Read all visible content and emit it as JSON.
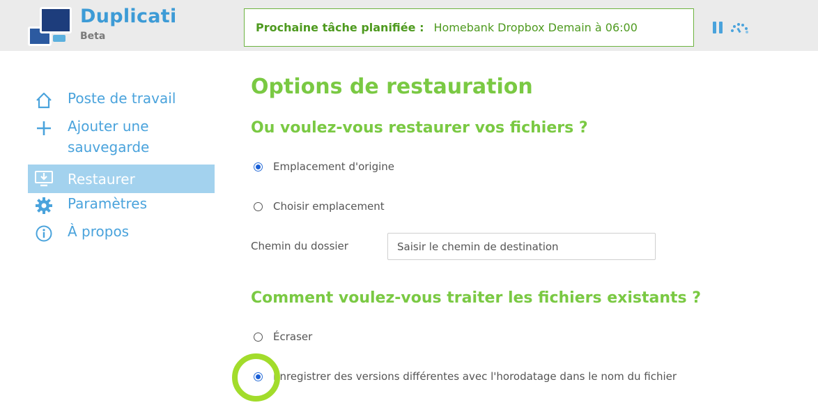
{
  "app": {
    "name": "Duplicati",
    "edition": "Beta"
  },
  "status": {
    "label": "Prochaine tâche planifiée :",
    "value": "Homebank Dropbox Demain à 06:00"
  },
  "header_icons": [
    "pause-icon",
    "throttle-icon"
  ],
  "nav": {
    "items": [
      {
        "label": "Poste de travail",
        "icon": "home-icon"
      },
      {
        "label": "Ajouter une",
        "label2": "sauvegarde",
        "icon": "plus-icon"
      },
      {
        "label": "Restaurer",
        "icon": "restore-icon",
        "active": true
      },
      {
        "label": "Paramètres",
        "icon": "gear-icon"
      },
      {
        "label": "À propos",
        "icon": "info-icon"
      }
    ]
  },
  "main": {
    "title": "Options de restauration",
    "where_section": {
      "title": "Ou voulez-vous restaurer vos fichiers ?",
      "options": [
        {
          "label": "Emplacement d'origine",
          "checked": true
        },
        {
          "label": "Choisir emplacement",
          "checked": false
        }
      ],
      "folder_label": "Chemin du dossier",
      "folder_placeholder": "Saisir le chemin de destination",
      "folder_value": ""
    },
    "existing_section": {
      "title": "Comment voulez-vous traiter les fichiers existants ?",
      "options": [
        {
          "label": "Écraser",
          "checked": false
        },
        {
          "label": "Enregistrer des versions différentes avec l'horodatage dans le nom du fichier",
          "checked": true
        }
      ]
    }
  },
  "colors": {
    "accent_blue": "#4aa3dc",
    "accent_green": "#7ac943",
    "status_green": "#4e9a1f",
    "active_nav_bg": "#a3d2ee",
    "highlight_ring": "#a2dc2b"
  }
}
